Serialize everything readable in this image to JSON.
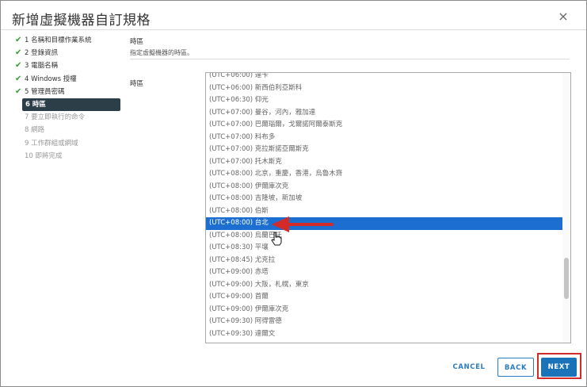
{
  "dialog": {
    "title": "新增虛擬機器自訂規格",
    "close_glyph": "×"
  },
  "steps": [
    {
      "label": "1 名稱和目標作業系統",
      "state": "done"
    },
    {
      "label": "2 登錄資訊",
      "state": "done"
    },
    {
      "label": "3 電腦名稱",
      "state": "done"
    },
    {
      "label": "4 Windows 授權",
      "state": "done"
    },
    {
      "label": "5 管理員密碼",
      "state": "done"
    },
    {
      "label": "6 時區",
      "state": "active"
    },
    {
      "label": "7 要立即執行的命令",
      "state": "pending"
    },
    {
      "label": "8 網路",
      "state": "pending"
    },
    {
      "label": "9 工作群組或網域",
      "state": "pending"
    },
    {
      "label": "10 即將完成",
      "state": "pending"
    }
  ],
  "check_glyph": "✔",
  "section": {
    "title": "時區",
    "description": "指定虛擬機器的時區。"
  },
  "timezone": {
    "label": "時區",
    "options": [
      "(UTC+06:00) 達卡",
      "(UTC+06:00) 新西伯利亞斯科",
      "(UTC+06:30) 仰光",
      "(UTC+07:00) 曼谷，河內，雅加達",
      "(UTC+07:00) 巴爾瑙爾，戈爾諾阿爾泰斯克",
      "(UTC+07:00) 科布多",
      "(UTC+07:00) 克拉斯諾亞爾斯克",
      "(UTC+07:00) 托木斯克",
      "(UTC+08:00) 北京，重慶，香港，烏魯木齊",
      "(UTC+08:00) 伊爾庫次克",
      "(UTC+08:00) 吉隆坡，新加坡",
      "(UTC+08:00) 伯斯",
      "(UTC+08:00) 台北",
      "(UTC+08:00) 烏蘭巴托",
      "(UTC+08:30) 平壤",
      "(UTC+08:45) 尤克拉",
      "(UTC+09:00) 赤塔",
      "(UTC+09:00) 大阪，札幌，東京",
      "(UTC+09:00) 首爾",
      "(UTC+09:00) 伊爾庫次克",
      "(UTC+09:30) 阿得雷德",
      "(UTC+09:30) 達爾文"
    ],
    "selected": "(UTC+08:00) 台北",
    "selected_index": 12,
    "list_scroll_fraction": 0.72
  },
  "footer": {
    "cancel": "CANCEL",
    "back": "BACK",
    "next": "NEXT"
  },
  "colors": {
    "selected_bg": "#1c6fd0",
    "active_step_bg": "#2c3e48",
    "annotation_red": "#d32a2a",
    "primary": "#1a73b9"
  }
}
